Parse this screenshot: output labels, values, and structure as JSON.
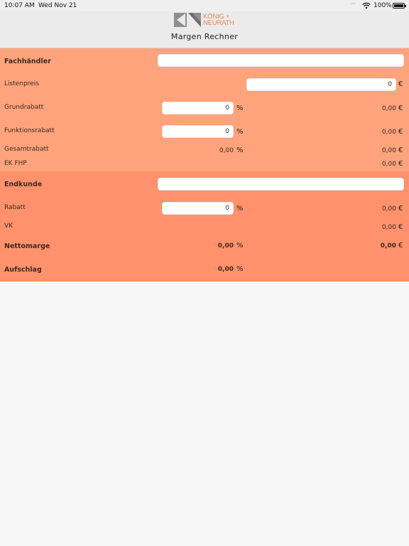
{
  "status_bar": {
    "time": "10:07 AM",
    "date": "Wed Nov 21",
    "battery": "100%"
  },
  "header": {
    "logo_line1": "KÖNIG +",
    "logo_line2": "NEURATH",
    "title": "Margen Rechner",
    "accent_color": "#e8835a"
  },
  "dealer": {
    "section_color": "#ffa37c",
    "label": "Fachhändler",
    "name_value": "",
    "listenpreis": {
      "label": "Listenpreis",
      "value": "0",
      "unit": "€"
    },
    "grundrabatt": {
      "label": "Grundrabatt",
      "value": "0",
      "pct_unit": "%",
      "amount": "0,00",
      "amount_unit": "€"
    },
    "funktionsrabatt": {
      "label": "Funktionsrabatt",
      "value": "0",
      "pct_unit": "%",
      "amount": "0,00",
      "amount_unit": "€"
    },
    "gesamtrabatt": {
      "label": "Gesamtrabatt",
      "pct": "0,00",
      "pct_unit": "%",
      "amount": "0,00",
      "amount_unit": "€"
    },
    "ek_fhp": {
      "label": "EK FHP",
      "amount": "0,00",
      "amount_unit": "€"
    }
  },
  "customer": {
    "section_color": "#ff926c",
    "label": "Endkunde",
    "name_value": "",
    "rabatt": {
      "label": "Rabatt",
      "value": "0",
      "pct_unit": "%",
      "amount": "0,00",
      "amount_unit": "€"
    },
    "vk": {
      "label": "VK",
      "amount": "0,00",
      "amount_unit": "€"
    },
    "nettomarge": {
      "label": "Nettomarge",
      "pct": "0,00",
      "pct_unit": "%",
      "amount": "0,00",
      "amount_unit": "€"
    },
    "aufschlag": {
      "label": "Aufschlag",
      "pct": "0,00",
      "pct_unit": "%"
    }
  }
}
